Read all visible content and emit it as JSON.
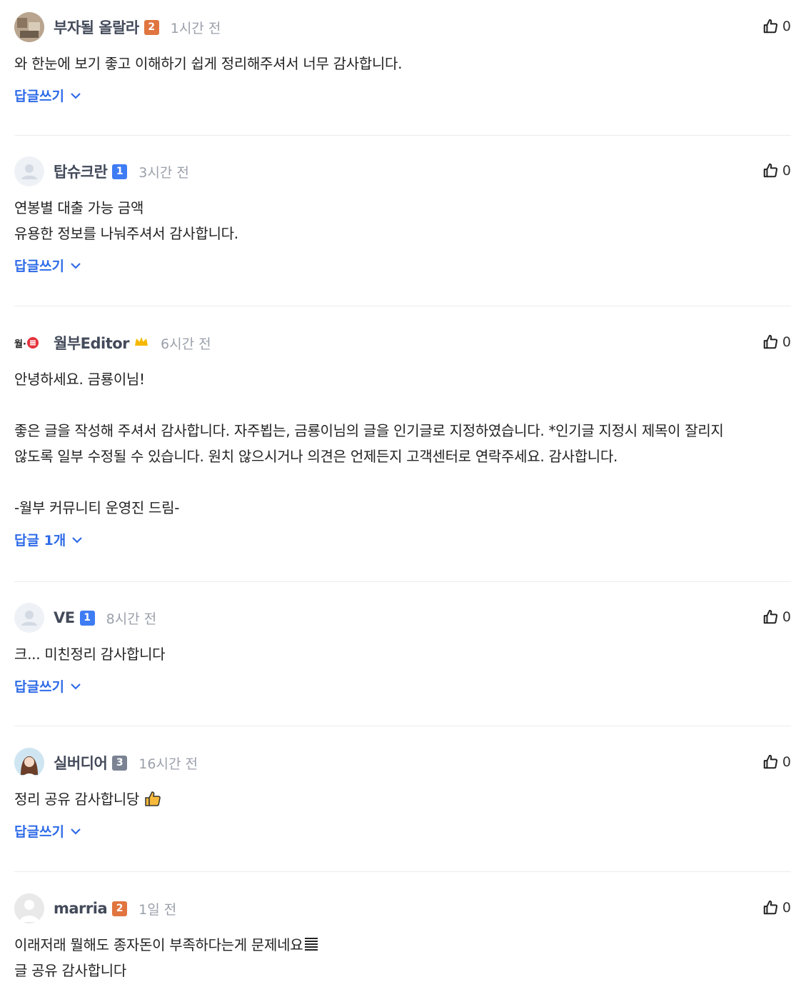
{
  "comments": [
    {
      "nick": "부자될 올랄라",
      "level": "2",
      "time": "1시간 전",
      "likes": "0",
      "lines": [
        "와 한눈에 보기 좋고 이해하기 쉽게 정리해주셔서 너무 감사합니다."
      ],
      "reply": "답글쓰기"
    },
    {
      "nick": "탑슈크란",
      "level": "1",
      "time": "3시간 전",
      "likes": "0",
      "lines": [
        "연봉별 대출 가능 금액",
        "유용한 정보를 나눠주셔서 감사합니다."
      ],
      "reply": "답글쓰기"
    },
    {
      "nick": "월부Editor",
      "time": "6시간 전",
      "likes": "0",
      "logo": "월·",
      "lines": [
        "안녕하세요. 금룡이님!",
        "",
        "좋은 글을 작성해 주셔서 감사합니다. 자주뵙는, 금룡이님의 글을 인기글로 지정하였습니다. *인기글 지정시 제목이 잘리지",
        "않도록 일부 수정될 수 있습니다. 원치 않으시거나 의견은 언제든지 고객센터로 연락주세요. 감사합니다.",
        "",
        "-월부 커뮤니티 운영진 드림-"
      ],
      "reply": "답글 1개"
    },
    {
      "nick": "VE",
      "level": "1",
      "time": "8시간 전",
      "likes": "0",
      "lines": [
        "크... 미친정리 감사합니다"
      ],
      "reply": "답글쓰기"
    },
    {
      "nick": "실버디어",
      "level": "3",
      "time": "16시간 전",
      "likes": "0",
      "lines": [
        "정리 공유 감사합니당"
      ],
      "reply": "답글쓰기"
    },
    {
      "nick": "marria",
      "level": "2",
      "time": "1일 전",
      "likes": "0",
      "lines": [
        "이래저래 뭘해도 종자돈이 부족하다는게 문제네요",
        "글 공유 감사합니다"
      ]
    }
  ],
  "icons": {
    "like": "thumbs-up-icon",
    "chevron": "chevron-down-icon",
    "crown": "crown-icon",
    "avatar_default": "user-icon"
  },
  "colors": {
    "accent": "#2f6be8",
    "level1": "#3e7cf4",
    "level2": "#e0753f",
    "level3": "#7b8393",
    "crown": "#f5b800"
  }
}
